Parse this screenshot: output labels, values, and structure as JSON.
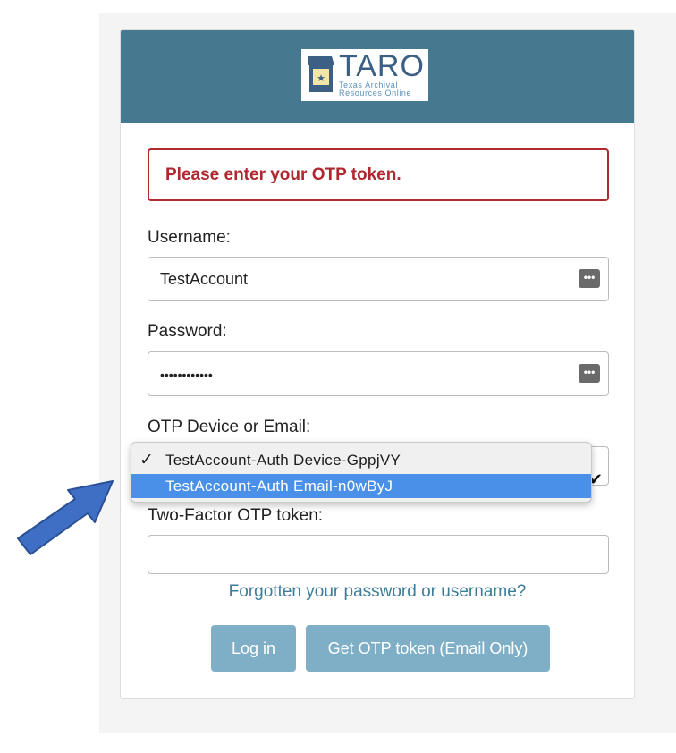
{
  "logo": {
    "word": "TARO",
    "subtitle": "Texas Archival Resources Online",
    "icon": "archive-box-icon"
  },
  "alert": {
    "message": "Please enter your OTP token."
  },
  "form": {
    "username_label": "Username:",
    "username_value": "TestAccount",
    "password_label": "Password:",
    "password_value": "••••••••••••",
    "otp_device_label": "OTP Device or Email:",
    "otp_token_label": "Two-Factor OTP token:",
    "otp_token_value": "",
    "password_manager_icon": "ellipsis-key-icon"
  },
  "dropdown": {
    "options": [
      {
        "label": "TestAccount-Auth Device-GppjVY",
        "checked": true,
        "highlighted": false
      },
      {
        "label": "TestAccount-Auth Email-n0wByJ",
        "checked": false,
        "highlighted": true
      }
    ]
  },
  "links": {
    "forgot": "Forgotten your password or username?"
  },
  "buttons": {
    "login": "Log in",
    "get_otp": "Get OTP token (Email Only)"
  },
  "colors": {
    "header": "#46788f",
    "alert": "#b0272f",
    "button": "#7fafc6",
    "link": "#3e7d9a",
    "highlight": "#4a90e8",
    "arrow": "#3f6fc4"
  }
}
